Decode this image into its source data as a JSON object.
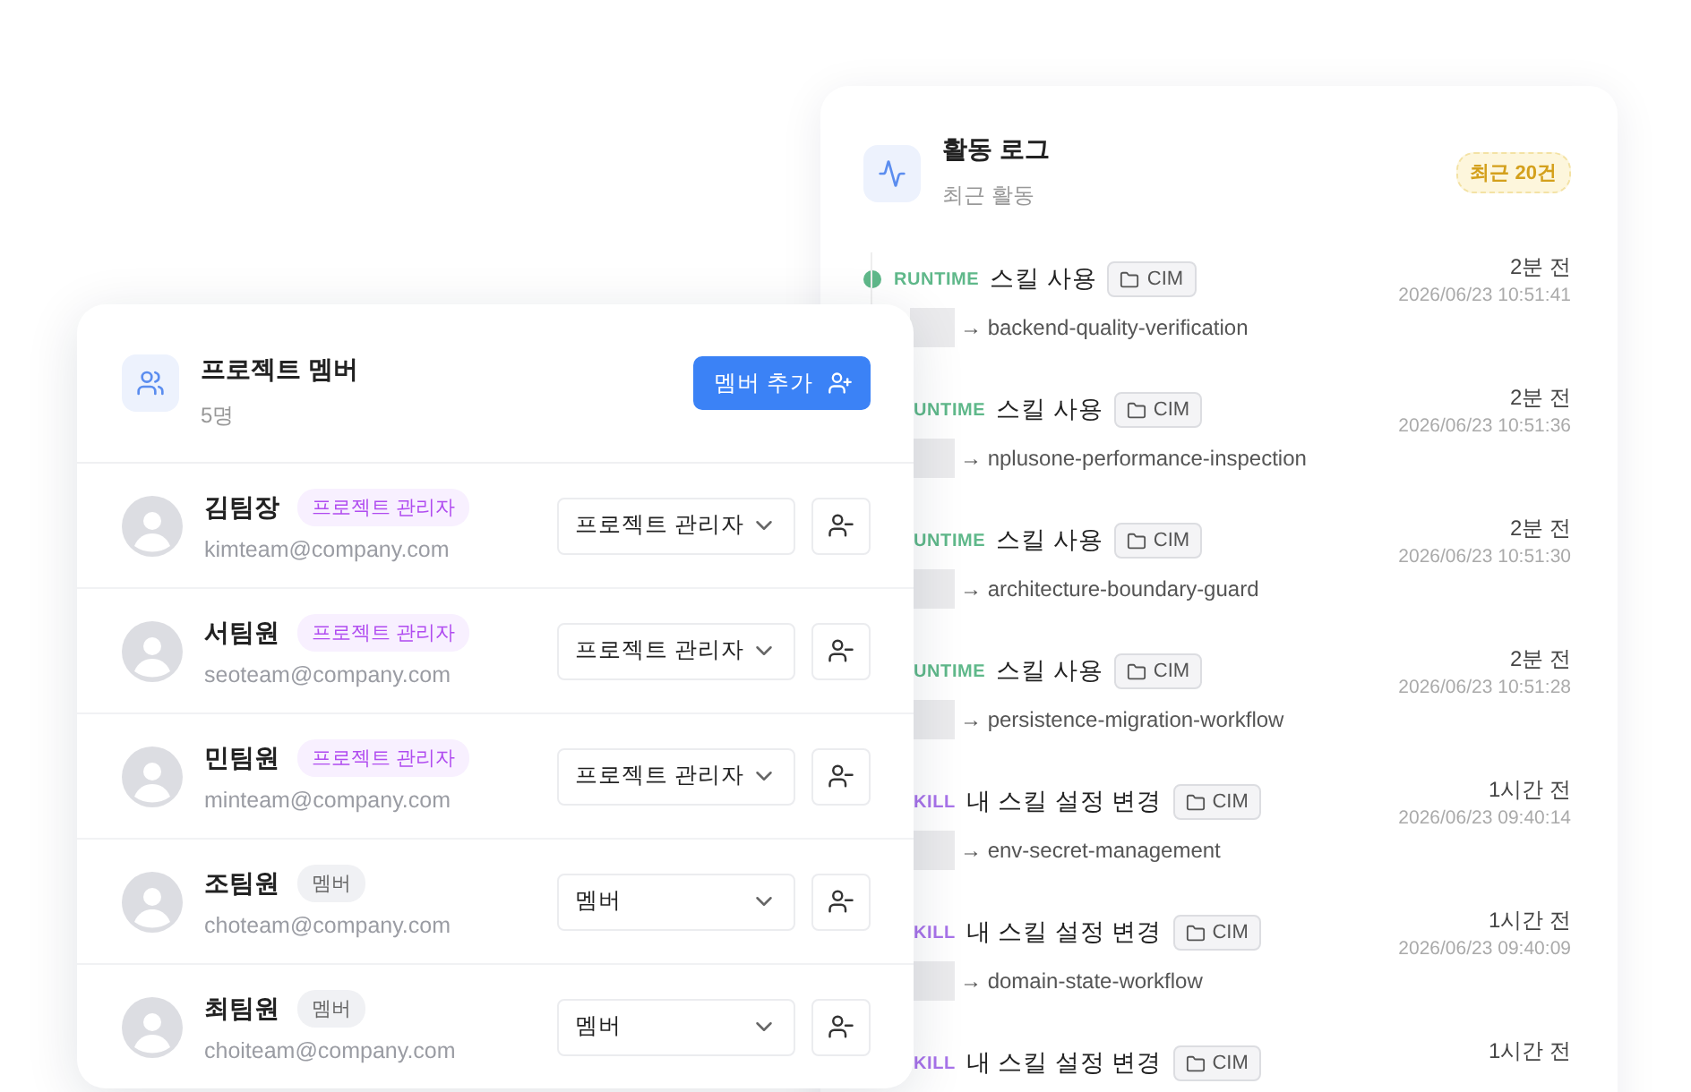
{
  "members_card": {
    "title": "프로젝트 멤버",
    "count": "5명",
    "add_button": "멤버 추가",
    "members": [
      {
        "name": "김팀장",
        "role_badge": "프로젝트 관리자",
        "kind": "admin",
        "email": "kimteam@company.com",
        "role_select": "프로젝트 관리자"
      },
      {
        "name": "서팀원",
        "role_badge": "프로젝트 관리자",
        "kind": "admin",
        "email": "seoteam@company.com",
        "role_select": "프로젝트 관리자"
      },
      {
        "name": "민팀원",
        "role_badge": "프로젝트 관리자",
        "kind": "admin",
        "email": "minteam@company.com",
        "role_select": "프로젝트 관리자"
      },
      {
        "name": "조팀원",
        "role_badge": "멤버",
        "kind": "member",
        "email": "choteam@company.com",
        "role_select": "멤버"
      },
      {
        "name": "최팀원",
        "role_badge": "멤버",
        "kind": "member",
        "email": "choiteam@company.com",
        "role_select": "멤버"
      }
    ]
  },
  "activity_card": {
    "title": "활동 로그",
    "subtitle": "최근 활동",
    "badge": "최근 20건",
    "items": [
      {
        "kind": "runtime",
        "dot": true,
        "label": "RUNTIME",
        "action": "스킬 사용",
        "project": "CIM",
        "target": "→ backend-quality-verification",
        "ago": "2분 전",
        "timestamp": "2026/06/23 10:51:41"
      },
      {
        "kind": "runtime",
        "dot": false,
        "label": "UNTIME",
        "action": "스킬 사용",
        "project": "CIM",
        "target": "→ nplusone-performance-inspection",
        "ago": "2분 전",
        "timestamp": "2026/06/23 10:51:36"
      },
      {
        "kind": "runtime",
        "dot": false,
        "label": "UNTIME",
        "action": "스킬 사용",
        "project": "CIM",
        "target": "→ architecture-boundary-guard",
        "ago": "2분 전",
        "timestamp": "2026/06/23 10:51:30"
      },
      {
        "kind": "runtime",
        "dot": false,
        "label": "UNTIME",
        "action": "스킬 사용",
        "project": "CIM",
        "target": "→ persistence-migration-workflow",
        "ago": "2분 전",
        "timestamp": "2026/06/23 10:51:28"
      },
      {
        "kind": "skill",
        "dot": false,
        "label": "KILL",
        "action": "내 스킬 설정 변경",
        "project": "CIM",
        "target": "→ env-secret-management",
        "ago": "1시간 전",
        "timestamp": "2026/06/23 09:40:14"
      },
      {
        "kind": "skill",
        "dot": false,
        "label": "KILL",
        "action": "내 스킬 설정 변경",
        "project": "CIM",
        "target": "→ domain-state-workflow",
        "ago": "1시간 전",
        "timestamp": "2026/06/23 09:40:09"
      },
      {
        "kind": "skill",
        "dot": false,
        "label": "KILL",
        "action": "내 스킬 설정 변경",
        "project": "CIM",
        "ago": "1시간 전"
      }
    ]
  }
}
